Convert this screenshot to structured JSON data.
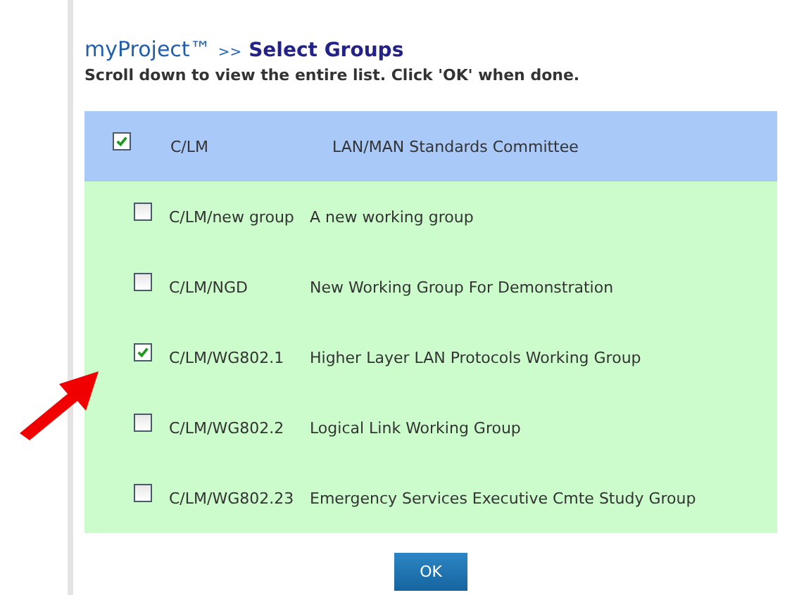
{
  "header": {
    "app": "myProject™",
    "separator": ">>",
    "page": "Select Groups"
  },
  "instruction": "Scroll down to view the entire list. Click 'OK' when done.",
  "groups": [
    {
      "kind": "parent",
      "checked": true,
      "code": "C/LM",
      "name": "LAN/MAN Standards Committee"
    },
    {
      "kind": "child",
      "checked": false,
      "code": "C/LM/new group",
      "name": "A new working group"
    },
    {
      "kind": "child",
      "checked": false,
      "code": "C/LM/NGD",
      "name": "New Working Group For Demonstration"
    },
    {
      "kind": "child",
      "checked": true,
      "code": "C/LM/WG802.1",
      "name": "Higher Layer LAN Protocols Working Group"
    },
    {
      "kind": "child",
      "checked": false,
      "code": "C/LM/WG802.2",
      "name": "Logical Link Working Group"
    },
    {
      "kind": "child",
      "checked": false,
      "code": "C/LM/WG802.23",
      "name": "Emergency Services Executive Cmte Study Group"
    }
  ],
  "buttons": [
    "OK"
  ]
}
